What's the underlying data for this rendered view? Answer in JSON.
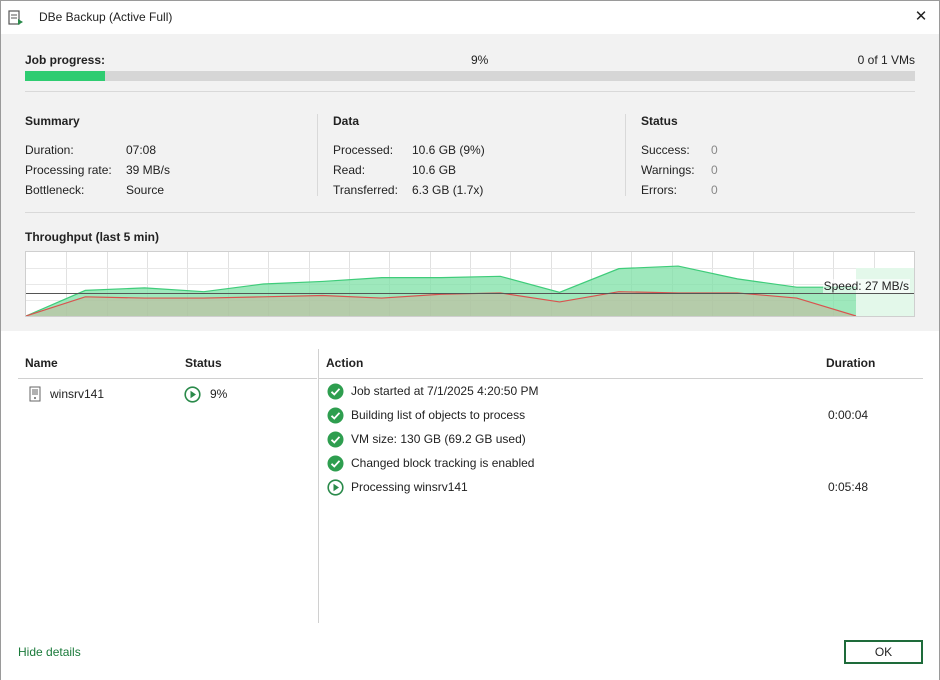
{
  "window": {
    "title": "DBe Backup (Active Full)"
  },
  "progress": {
    "label": "Job progress:",
    "percent": "9%",
    "fraction": 0.09,
    "count": "0 of 1 VMs"
  },
  "summary": {
    "heading": "Summary",
    "rows": [
      {
        "k": "Duration:",
        "v": "07:08"
      },
      {
        "k": "Processing rate:",
        "v": "39 MB/s"
      },
      {
        "k": "Bottleneck:",
        "v": "Source"
      }
    ]
  },
  "data_section": {
    "heading": "Data",
    "rows": [
      {
        "k": "Processed:",
        "v": "10.6 GB (9%)"
      },
      {
        "k": "Read:",
        "v": "10.6 GB"
      },
      {
        "k": "Transferred:",
        "v": "6.3 GB (1.7x)"
      }
    ]
  },
  "status_section": {
    "heading": "Status",
    "rows": [
      {
        "k": "Success:",
        "v": "0"
      },
      {
        "k": "Warnings:",
        "v": "0"
      },
      {
        "k": "Errors:",
        "v": "0"
      }
    ]
  },
  "throughput": {
    "title": "Throughput (last 5 min)",
    "speed": "Speed: 27 MB/s"
  },
  "chart_data": {
    "type": "area",
    "title": "Throughput (last 5 min)",
    "series": [
      {
        "values": [
          0,
          40,
          44,
          38,
          50,
          54,
          60,
          60,
          62,
          37,
          74,
          78,
          58,
          45,
          45
        ]
      },
      {
        "values": [
          0,
          30,
          28,
          28,
          30,
          32,
          28,
          34,
          36,
          22,
          38,
          36,
          36,
          28,
          0
        ]
      }
    ],
    "ylim": [
      0,
      100
    ],
    "grid": true,
    "colors": {
      "fill": "#7ee0a6",
      "line_green": "#3fcc7a",
      "line_red": "#d9534f",
      "speed_line": "#555555"
    }
  },
  "table": {
    "name_header": "Name",
    "status_header": "Status",
    "action_header": "Action",
    "duration_header": "Duration",
    "vm": {
      "name": "winsrv141",
      "status": "9%"
    },
    "actions": [
      {
        "text": "Job started at 7/1/2025 4:20:50 PM",
        "duration": "",
        "icon": "success-icon"
      },
      {
        "text": "Building list of objects to process",
        "duration": "0:00:04",
        "icon": "success-icon"
      },
      {
        "text": "VM size: 130 GB (69.2 GB used)",
        "duration": "",
        "icon": "success-icon"
      },
      {
        "text": "Changed block tracking is enabled",
        "duration": "",
        "icon": "success-icon"
      },
      {
        "text": "Processing winsrv141",
        "duration": "0:05:48",
        "icon": "play-icon"
      }
    ]
  },
  "footer": {
    "hide_details": "Hide details",
    "ok": "OK"
  },
  "colors": {
    "accent": "#2ecc71",
    "button_border": "#1e6b3a",
    "link": "#1a7a3a"
  }
}
